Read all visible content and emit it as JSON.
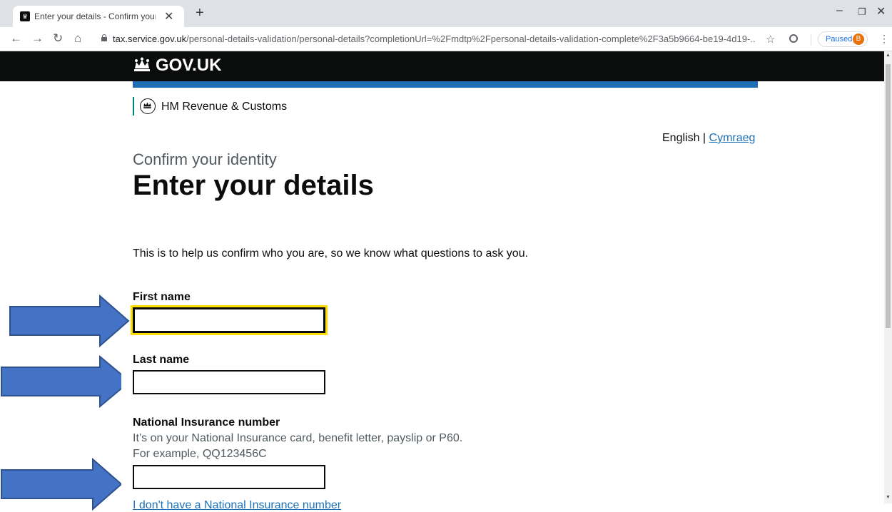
{
  "browser": {
    "tab_title": "Enter your details - Confirm your",
    "url_host": "tax.service.gov.uk",
    "url_path": "/personal-details-validation/personal-details?completionUrl=%2Fmdtp%2Fpersonal-details-validation-complete%2F3a5b9664-be19-4d19-...",
    "paused_label": "Paused",
    "avatar_letter": "B"
  },
  "header": {
    "logo_text": "GOV.UK",
    "department": "HM Revenue & Customs"
  },
  "language": {
    "current": "English",
    "separator": " | ",
    "other": "Cymraeg"
  },
  "page": {
    "caption": "Confirm your identity",
    "title": "Enter your details",
    "intro": "This is to help us confirm who you are, so we know what questions to ask you."
  },
  "form": {
    "first_name": {
      "label": "First name",
      "value": ""
    },
    "last_name": {
      "label": "Last name",
      "value": ""
    },
    "nino": {
      "label": "National Insurance number",
      "hint_1": "It’s on your National Insurance card, benefit letter, payslip or P60.",
      "hint_2": "For example, QQ123456C",
      "value": ""
    },
    "partial_link": "I don't have a National Insurance number"
  },
  "colors": {
    "govuk_black": "#0b0c0c",
    "govuk_blue": "#1d70b8",
    "focus_yellow": "#ffdd00",
    "arrow_fill": "#4472c4",
    "arrow_stroke": "#2f528f"
  },
  "annotations": {
    "arrow_count": 3
  }
}
